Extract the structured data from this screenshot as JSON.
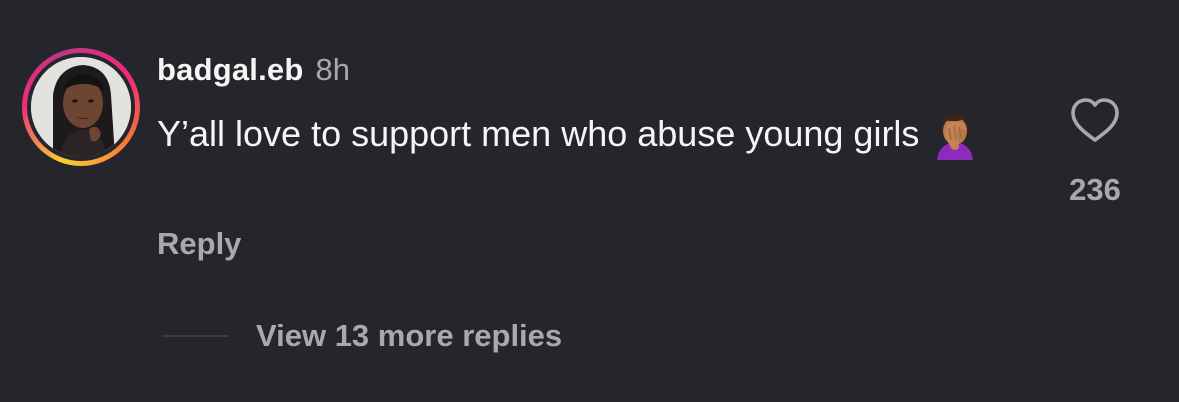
{
  "comment": {
    "username": "badgal.eb",
    "timestamp": "8h",
    "text": "Y’all love to support men who abuse young girls",
    "emoji": "face-palm-emoji",
    "reply_label": "Reply",
    "like_count": "236",
    "like_icon": "heart-icon",
    "view_replies_label": "View 13 more replies"
  },
  "colors": {
    "background": "#25262b",
    "primary_text": "#f5f5f5",
    "secondary_text": "#a8a8ad",
    "story_ring_start": "#f9ce34",
    "story_ring_mid": "#ee2a7b",
    "story_ring_end": "#c13584"
  }
}
